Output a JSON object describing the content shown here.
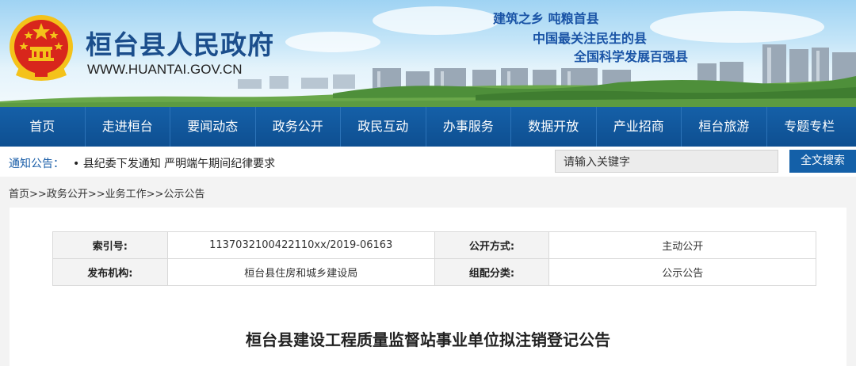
{
  "header": {
    "site_title": "桓台县人民政府",
    "site_url": "WWW.HUANTAI.GOV.CN",
    "slogans": [
      "建筑之乡 吨粮首县",
      "中国最关注民生的县",
      "全国科学发展百强县"
    ]
  },
  "nav": {
    "items": [
      "首页",
      "走进桓台",
      "要闻动态",
      "政务公开",
      "政民互动",
      "办事服务",
      "数据开放",
      "产业招商",
      "桓台旅游",
      "专题专栏"
    ]
  },
  "notice": {
    "label": "通知公告：",
    "text": "• 县纪委下发通知 严明端午期间纪律要求"
  },
  "search": {
    "placeholder": "请输入关键字",
    "button_label": "全文搜索"
  },
  "breadcrumb": {
    "items": [
      "首页",
      "政务公开",
      "业务工作",
      "公示公告"
    ],
    "separator": ">>"
  },
  "meta": {
    "index_label": "索引号:",
    "index_value": "1137032100422110xx/2019-06163",
    "open_label": "公开方式:",
    "open_value": "主动公开",
    "org_label": "发布机构:",
    "org_value": "桓台县住房和城乡建设局",
    "category_label": "组配分类:",
    "category_value": "公示公告"
  },
  "document": {
    "title": "桓台县建设工程质量监督站事业单位拟注销登记公告"
  },
  "colors": {
    "nav_bg": "#0e4f91",
    "accent": "#1460a8",
    "emblem_red": "#d8261c",
    "emblem_gold": "#f4c21a"
  }
}
